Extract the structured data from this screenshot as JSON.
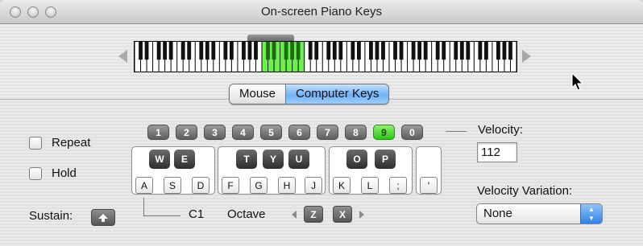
{
  "window": {
    "title": "On-screen Piano Keys"
  },
  "piano": {
    "highlight_color": "#6cf04c",
    "octaves_total": 9,
    "highlighted_octave": 3
  },
  "input_mode": {
    "options": [
      "Mouse",
      "Computer Keys"
    ],
    "selected": "Computer Keys"
  },
  "options": {
    "repeat_label": "Repeat",
    "hold_label": "Hold",
    "repeat_checked": false,
    "hold_checked": false
  },
  "number_keys": {
    "labels": [
      "1",
      "2",
      "3",
      "4",
      "5",
      "6",
      "7",
      "8",
      "9",
      "0"
    ],
    "active": "9",
    "active_color": "#39cd23"
  },
  "keyboard": {
    "black_keys": [
      "W",
      "E",
      "T",
      "Y",
      "U",
      "O",
      "P"
    ],
    "white_keys": [
      "A",
      "S",
      "D",
      "F",
      "G",
      "H",
      "J",
      "K",
      "L",
      ";",
      "'"
    ]
  },
  "sustain": {
    "label": "Sustain:",
    "key_icon": "up-arrow-icon"
  },
  "octave": {
    "start_note": "C1",
    "label": "Octave",
    "down_key": "Z",
    "up_key": "X"
  },
  "velocity": {
    "label": "Velocity:",
    "value": "112"
  },
  "velocity_variation": {
    "label": "Velocity Variation:",
    "selected": "None"
  }
}
